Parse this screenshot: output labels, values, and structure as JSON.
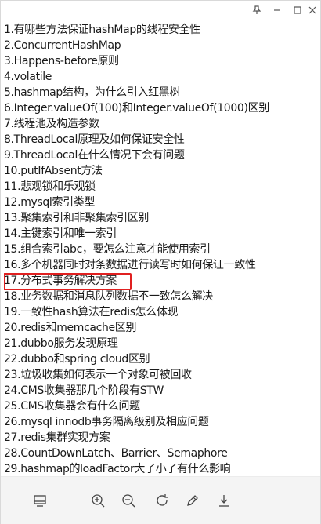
{
  "window_controls": {
    "pin_icon": "pin-icon",
    "minimize_icon": "minimize-icon",
    "maximize_icon": "maximize-icon",
    "close_icon": "close-icon"
  },
  "items": [
    "1.有哪些方法保证hashMap的线程安全性",
    "2.ConcurrentHashMap",
    "3.Happens-before原则",
    "4.volatile",
    "5.hashmap结构，为什么引入红黑树",
    "6.Integer.valueOf(100)和Integer.valueOf(1000)区别",
    "7.线程池及构造参数",
    "8.ThreadLocal原理及如何保证安全性",
    "9.ThreadLocal在什么情况下会有问题",
    "10.putIfAbsent方法",
    "11.悲观锁和乐观锁",
    "12.mysql索引类型",
    "13.聚集索引和非聚集索引区别",
    "14.主键索引和唯一索引",
    "15.组合索引abc，要怎么注意才能使用索引",
    "16.多个机器同时对条数据进行读写时如何保证一致性",
    "17.分布式事务解决方案",
    "18.业务数据和消息队列数据不一致怎么解决",
    "19.一致性hash算法在redis怎么体现",
    "20.redis和memcache区别",
    "21.dubbo服务发现原理",
    "22.dubbo和spring cloud区别",
    "23.垃圾收集如何表示一个对象可被回收",
    "24.CMS收集器那几个阶段有STW",
    "25.CMS收集器会有什么问题",
    "26.mysql innodb事务隔离级别及相应问题",
    "27.redis集群实现方案",
    "28.CountDownLatch、Barrier、Semaphore",
    "29.hashmap的loadFactor大了小了有什么影响"
  ],
  "highlighted_index": 16,
  "highlight_color": "#e02020",
  "toolbar": {
    "icons": [
      "fit-page-icon",
      "zoom-in-icon",
      "zoom-out-icon",
      "rotate-icon",
      "edit-icon",
      "download-icon"
    ]
  }
}
